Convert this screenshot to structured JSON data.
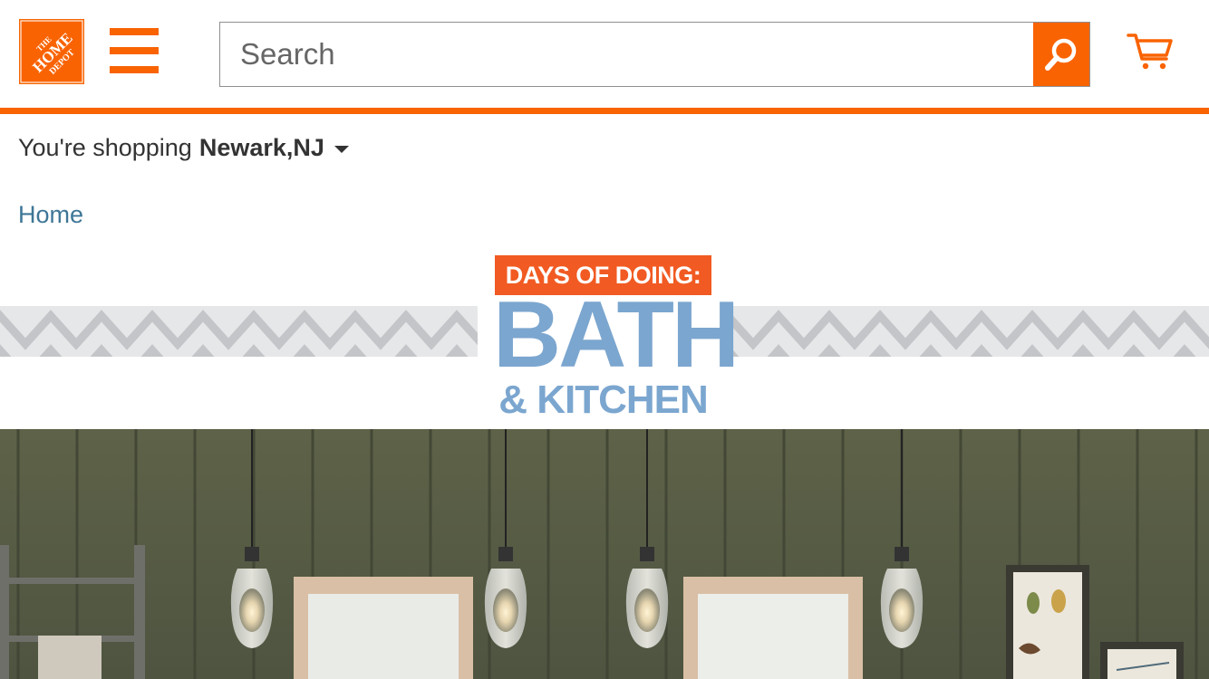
{
  "header": {
    "logo_text": "THE HOME DEPOT",
    "brand_color": "#f96302",
    "search_placeholder": "Search",
    "search_value": "",
    "icons": {
      "menu": "hamburger-menu-icon",
      "search": "magnifier-icon",
      "cart": "shopping-cart-icon"
    }
  },
  "store": {
    "prefix": "You're shopping",
    "name": "Newark,NJ"
  },
  "breadcrumb": {
    "home": "Home"
  },
  "promo": {
    "tag": "DAYS OF DOING:",
    "title": "BATH",
    "subtitle": "& KITCHEN",
    "tag_color": "#f15a22",
    "title_color": "#7ba6cf"
  },
  "hero": {
    "scene": "bathroom with pendant lights, framed mirrors and wall art"
  }
}
